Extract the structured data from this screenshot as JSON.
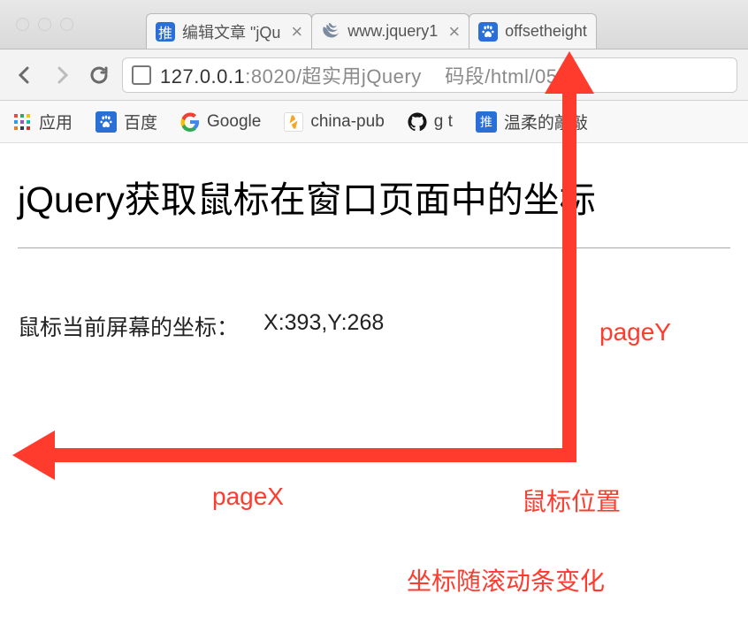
{
  "tabs": [
    {
      "title": "编辑文章 \"jQu",
      "favicon": "tuicool"
    },
    {
      "title": "www.jquery1",
      "favicon": "jquery"
    },
    {
      "title": "offsetheight",
      "favicon": "baidu-paw"
    }
  ],
  "address_bar": {
    "host": "127.0.0.1",
    "port": ":8020",
    "path_prefix": "/超实用jQuery",
    "path_gap": "码段",
    "path_suffix": "/html/05.h"
  },
  "bookmarks": [
    {
      "label": "应用",
      "icon": "apps"
    },
    {
      "label": "百度",
      "icon": "baidu"
    },
    {
      "label": "Google",
      "icon": "google"
    },
    {
      "label": "china-pub",
      "icon": "chinapub"
    },
    {
      "label": "g t",
      "icon": "github"
    },
    {
      "label": "温柔的敲敲",
      "icon": "tuicool"
    }
  ],
  "page": {
    "heading": "jQuery获取鼠标在窗口页面中的坐标",
    "coord_label": "鼠标当前屏幕的坐标：",
    "coord_value": "X:393,Y:268"
  },
  "annotations": {
    "pageY": "pageY",
    "pageX": "pageX",
    "mouse_pos": "鼠标位置",
    "scroll_note": "坐标随滚动条变化",
    "arrow_color": "#ff3b2e"
  }
}
